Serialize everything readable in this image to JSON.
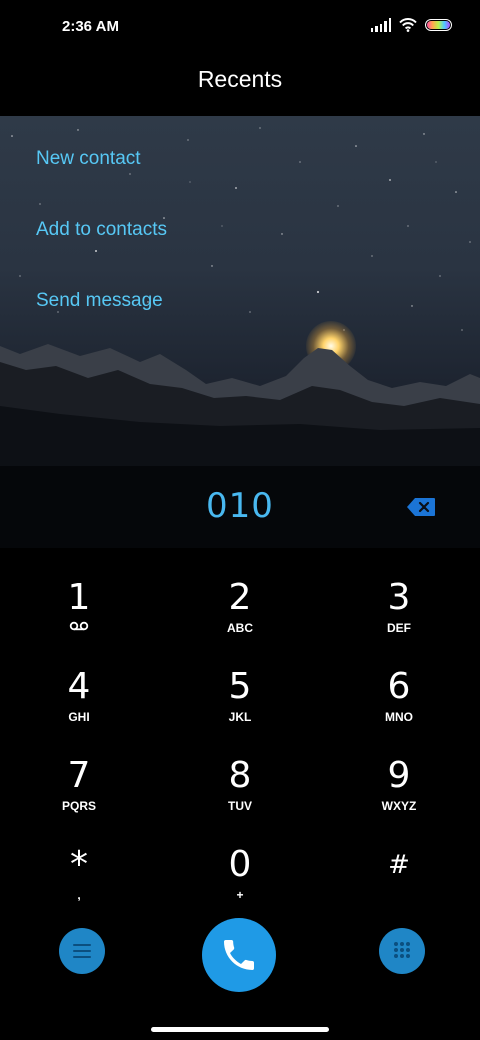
{
  "status_bar": {
    "time": "2:36 AM",
    "icons": [
      "signal-icon",
      "wifi-icon",
      "battery-icon"
    ]
  },
  "header": {
    "title": "Recents"
  },
  "actions": [
    {
      "label": "New contact"
    },
    {
      "label": "Add to contacts"
    },
    {
      "label": "Send message"
    }
  ],
  "dialer": {
    "number": "010",
    "backspace_icon": "backspace-icon"
  },
  "keypad": {
    "keys": [
      {
        "digit": "1",
        "sub": "",
        "sub_icon": "voicemail-icon"
      },
      {
        "digit": "2",
        "sub": "ABC"
      },
      {
        "digit": "3",
        "sub": "DEF"
      },
      {
        "digit": "4",
        "sub": "GHI"
      },
      {
        "digit": "5",
        "sub": "JKL"
      },
      {
        "digit": "6",
        "sub": "MNO"
      },
      {
        "digit": "7",
        "sub": "PQRS"
      },
      {
        "digit": "8",
        "sub": "TUV"
      },
      {
        "digit": "9",
        "sub": "WXYZ"
      },
      {
        "digit": "*",
        "sub": ","
      },
      {
        "digit": "0",
        "sub": "+"
      },
      {
        "digit": "#",
        "sub": ""
      }
    ]
  },
  "bottom_bar": {
    "menu_icon": "menu-icon",
    "call_icon": "phone-icon",
    "keypad_icon": "dialpad-icon"
  },
  "colors": {
    "accent": "#57c8f5",
    "number": "#49b8f0",
    "call_button": "#1f9ae6",
    "side_button": "#1f86c6",
    "background": "#000000"
  }
}
